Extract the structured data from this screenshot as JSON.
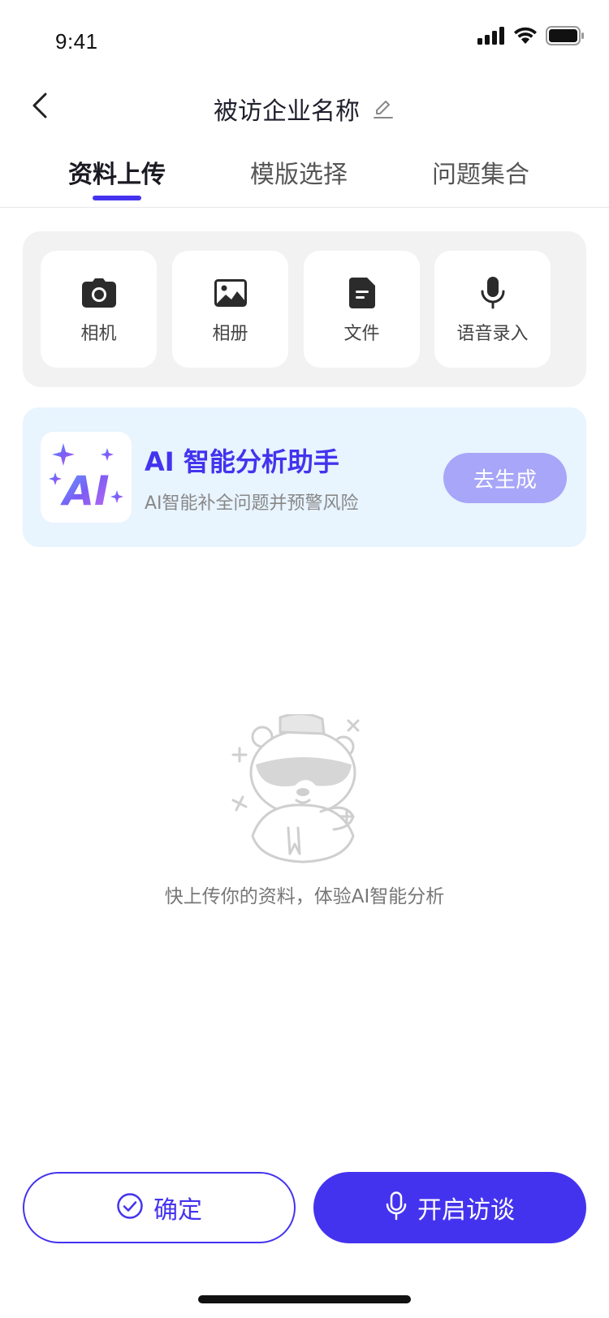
{
  "status_bar": {
    "time": "9:41"
  },
  "nav": {
    "title": "被访企业名称"
  },
  "tabs": [
    {
      "label": "资料上传",
      "active": true
    },
    {
      "label": "模版选择",
      "active": false
    },
    {
      "label": "问题集合",
      "active": false
    }
  ],
  "upload": {
    "items": [
      {
        "label": "相机",
        "icon": "camera-icon"
      },
      {
        "label": "相册",
        "icon": "image-icon"
      },
      {
        "label": "文件",
        "icon": "file-icon"
      },
      {
        "label": "语音录入",
        "icon": "microphone-icon"
      }
    ]
  },
  "ai_card": {
    "title": "AI 智能分析助手",
    "subtitle": "AI智能补全问题并预警风险",
    "button": "去生成",
    "logo_text": "AI"
  },
  "empty_state": {
    "text": "快上传你的资料，体验AI智能分析"
  },
  "actions": {
    "confirm": "确定",
    "start_interview": "开启访谈"
  },
  "colors": {
    "accent": "#4433ee",
    "ai_button": "#a8a6f8",
    "ai_card_bg": "#e8f4fe"
  }
}
